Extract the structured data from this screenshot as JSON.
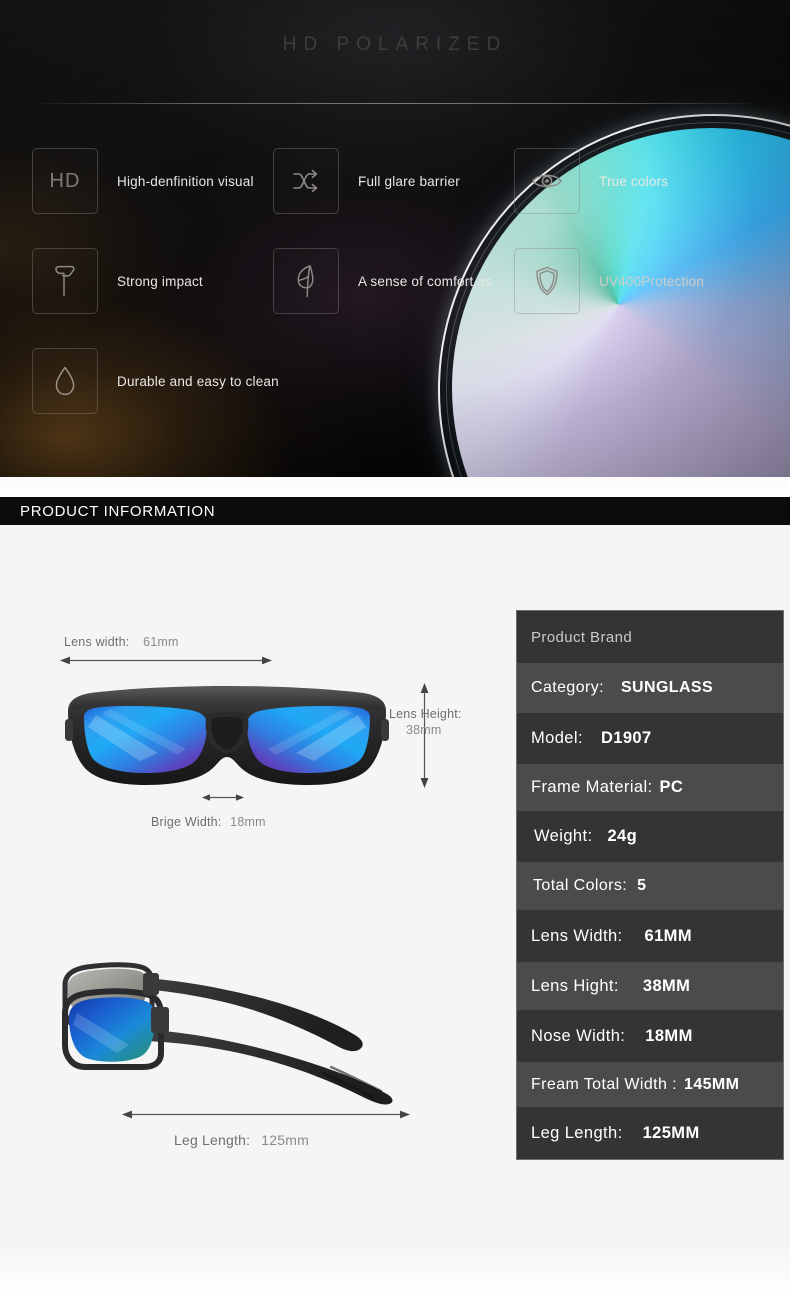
{
  "hero": {
    "title": "HD POLARIZED",
    "features": [
      {
        "icon": "hd-icon",
        "label": "High-denfinition visual"
      },
      {
        "icon": "shuffle-icon",
        "label": "Full glare barrier"
      },
      {
        "icon": "eye-icon",
        "label": "True colors"
      },
      {
        "icon": "hammer-icon",
        "label": "Strong impact"
      },
      {
        "icon": "feather-icon",
        "label": "A sense of comfort,as"
      },
      {
        "icon": "shield-icon",
        "label": "UV400Protection"
      },
      {
        "icon": "droplet-icon",
        "label": "Durable and easy to clean"
      }
    ]
  },
  "banner": {
    "title": "PRODUCT INFORMATION"
  },
  "diagram": {
    "front": {
      "lens_width_label": "Lens width:",
      "lens_width_value": "61mm",
      "lens_height_label": "Lens Height:",
      "lens_height_value": "38mm",
      "bridge_label": "Brige Width:",
      "bridge_value": "18mm"
    },
    "side": {
      "leg_label": "Leg Length:",
      "leg_value": "125mm"
    }
  },
  "specs": {
    "brand_label": "Product Brand",
    "rows": [
      {
        "key": "Category:",
        "value": "SUNGLASS"
      },
      {
        "key": "Model:",
        "value": "D1907"
      },
      {
        "key": "Frame Material:",
        "value": "PC"
      },
      {
        "key": "Weight:",
        "value": "24g"
      },
      {
        "key": "Total Colors:",
        "value": "5"
      },
      {
        "key": "Lens Width:",
        "value": "61MM"
      },
      {
        "key": "Lens Hight:",
        "value": "38MM"
      },
      {
        "key": "Nose Width:",
        "value": "18MM"
      },
      {
        "key": "Fream Total Width :",
        "value": "145MM"
      },
      {
        "key": "Leg Length:",
        "value": "125MM"
      }
    ]
  },
  "colors": {
    "frame": "#2b2b2d",
    "lens_blue": "#1f8fe0",
    "lens_purple": "#6a3fb5",
    "banner_bg": "#0b0b0b",
    "page_bg": "#f5f5f5",
    "row_dark": "#333436",
    "row_light": "#4a4b4d"
  }
}
